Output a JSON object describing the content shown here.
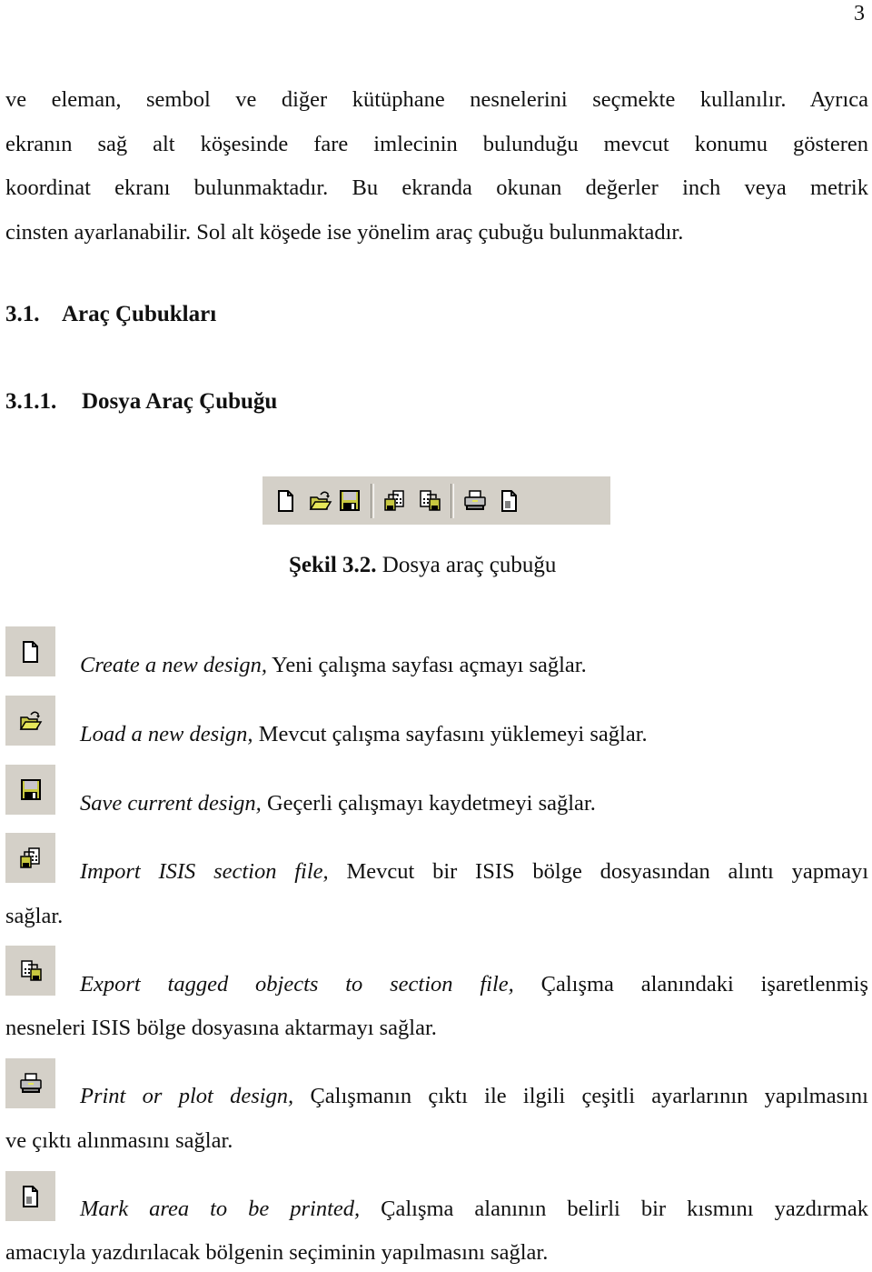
{
  "page": {
    "number": "3",
    "intro_lines": [
      "ve eleman, sembol ve diğer kütüphane nesnelerini seçmekte kullanılır. Ayrıca",
      "ekranın sağ alt köşesinde fare imlecinin bulunduğu mevcut konumu gösteren",
      "koordinat ekranı bulunmaktadır. Bu ekranda okunan değerler inch veya metrik",
      "cinsten ayarlanabilir. Sol alt köşede ise yönelim araç çubuğu bulunmaktadır."
    ],
    "section": {
      "number": "3.1.",
      "title": "Araç Çubukları"
    },
    "subsection": {
      "number": "3.1.1.",
      "title": "Dosya Araç Çubuğu"
    },
    "figure": {
      "label": "Şekil 3.2.",
      "caption": " Dosya araç çubuğu",
      "toolbar": {
        "background": "#d4d0c8",
        "groups": [
          [
            "new-design-icon",
            "open-design-icon",
            "save-design-icon"
          ],
          [
            "import-section-icon",
            "export-section-icon"
          ],
          [
            "print-icon",
            "mark-print-area-icon"
          ]
        ]
      }
    },
    "items": [
      {
        "icon": "new-design-icon",
        "command": "Create a new design,",
        "description": " Yeni çalışma sayfası açmayı sağlar."
      },
      {
        "icon": "open-design-icon",
        "command": "Load a new design,",
        "description": " Mevcut çalışma sayfasını yüklemeyi sağlar."
      },
      {
        "icon": "save-design-icon",
        "command": "Save current design,",
        "description": " Geçerli çalışmayı kaydetmeyi sağlar."
      },
      {
        "icon": "import-section-icon",
        "command": "Import ISIS section file,",
        "description": " Mevcut bir ISIS bölge dosyasından alıntı yapmayı",
        "continuation": "sağlar."
      },
      {
        "icon": "export-section-icon",
        "command": "Export tagged objects to section file,",
        "description": " Çalışma alanındaki işaretlenmiş",
        "continuation": "nesneleri ISIS bölge dosyasına aktarmayı sağlar."
      },
      {
        "icon": "print-icon",
        "command": "Print or plot design,",
        "description": " Çalışmanın çıktı ile ilgili çeşitli ayarlarının yapılmasını",
        "continuation": "ve çıktı alınmasını sağlar."
      },
      {
        "icon": "mark-print-area-icon",
        "command": "Mark area to be printed,",
        "description": " Çalışma alanının belirli bir kısmını yazdırmak",
        "continuation": "amacıyla yazdırılacak bölgenin seçiminin yapılmasını sağlar."
      }
    ]
  }
}
